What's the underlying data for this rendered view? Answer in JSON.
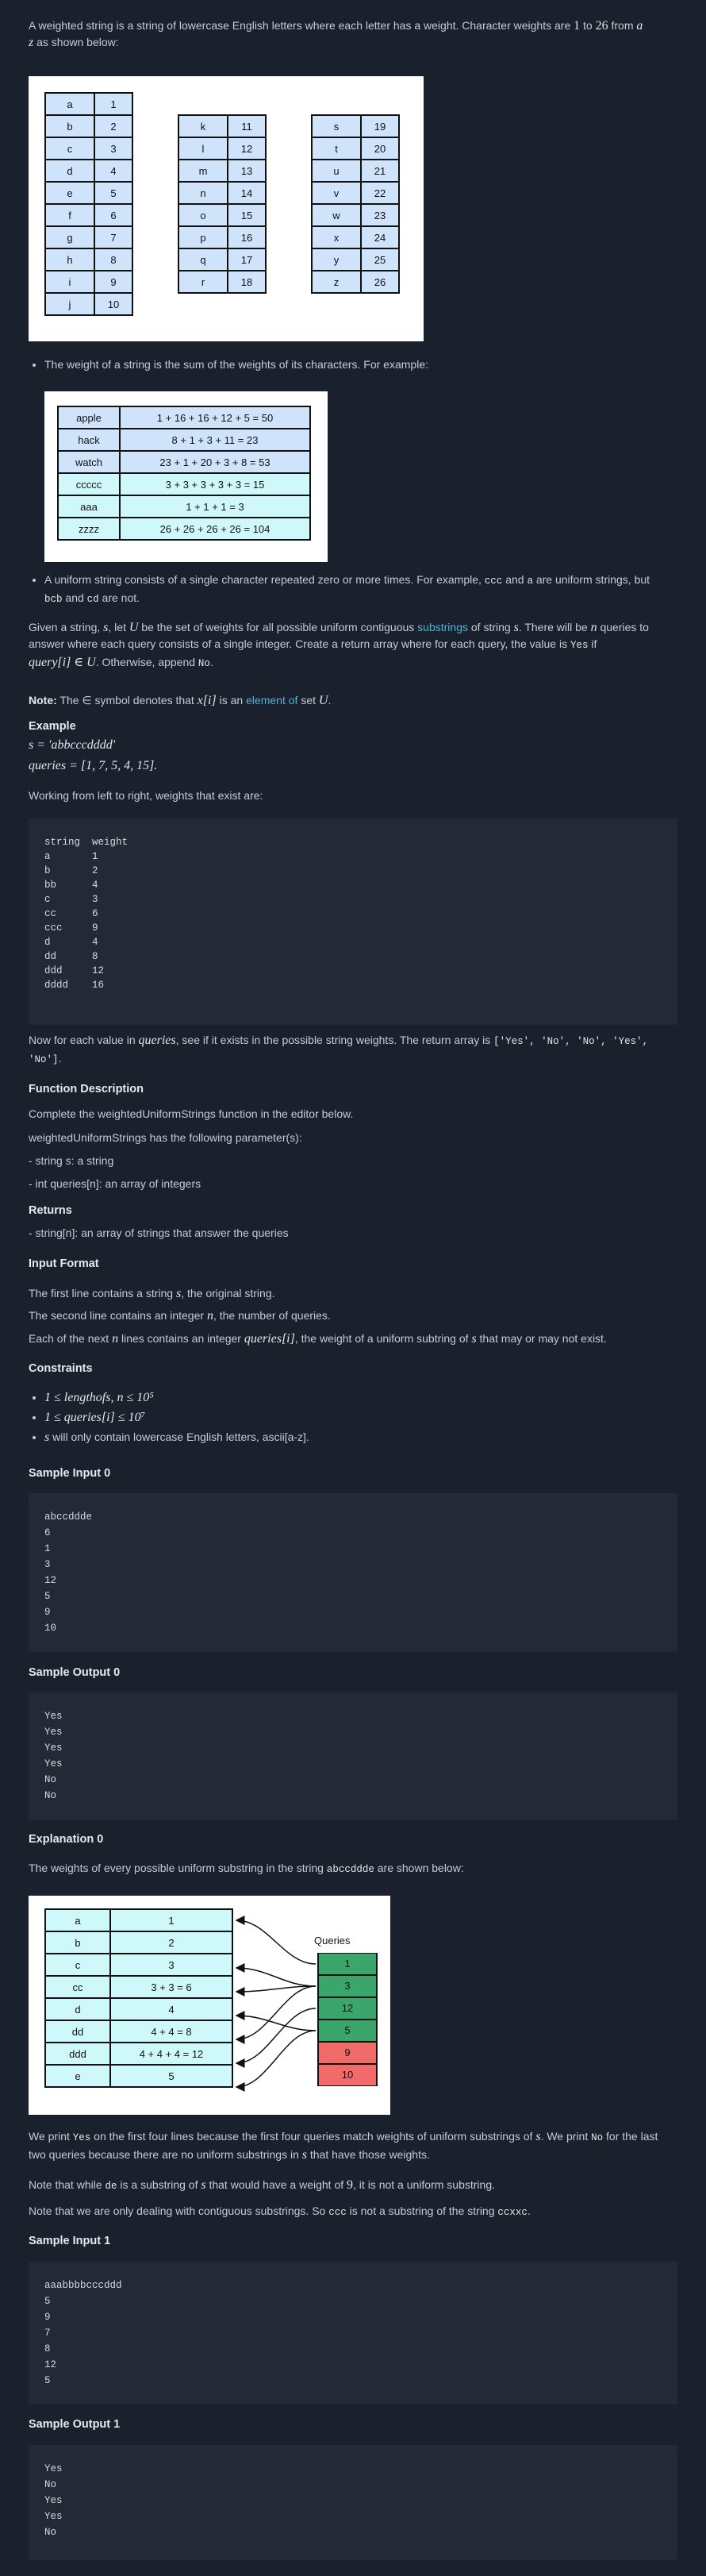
{
  "intro": {
    "text1": "A weighted string is a string of lowercase English letters where each letter has a weight. Character weights are ",
    "n1": "1",
    "to": " to ",
    "n26": "26",
    "from": " from ",
    "a": "a",
    "to2": " to ",
    "z": "z",
    "tail": " as shown below:"
  },
  "weights_table": {
    "col1": [
      [
        "a",
        "1"
      ],
      [
        "b",
        "2"
      ],
      [
        "c",
        "3"
      ],
      [
        "d",
        "4"
      ],
      [
        "e",
        "5"
      ],
      [
        "f",
        "6"
      ],
      [
        "g",
        "7"
      ],
      [
        "h",
        "8"
      ],
      [
        "i",
        "9"
      ],
      [
        "j",
        "10"
      ]
    ],
    "col2": [
      [
        "k",
        "11"
      ],
      [
        "l",
        "12"
      ],
      [
        "m",
        "13"
      ],
      [
        "n",
        "14"
      ],
      [
        "o",
        "15"
      ],
      [
        "p",
        "16"
      ],
      [
        "q",
        "17"
      ],
      [
        "r",
        "18"
      ]
    ],
    "col3": [
      [
        "s",
        "19"
      ],
      [
        "t",
        "20"
      ],
      [
        "u",
        "21"
      ],
      [
        "v",
        "22"
      ],
      [
        "w",
        "23"
      ],
      [
        "x",
        "24"
      ],
      [
        "y",
        "25"
      ],
      [
        "z",
        "26"
      ]
    ]
  },
  "bullet1": "The weight of a string is the sum of the weights of its characters. For example:",
  "examples_table": [
    [
      "apple",
      "1 + 16 + 16 + 12 + 5 = 50"
    ],
    [
      "hack",
      "8 + 1 + 3 + 11 = 23"
    ],
    [
      "watch",
      "23 + 1 + 20 + 3 + 8 = 53"
    ],
    [
      "ccccc",
      "3 + 3 + 3 + 3 + 3 = 15"
    ],
    [
      "aaa",
      "1 + 1 + 1 = 3"
    ],
    [
      "zzzz",
      "26 + 26 + 26 + 26 = 104"
    ]
  ],
  "bullet2": {
    "pre": "A uniform string consists of a single character repeated zero or more times. For example, ",
    "c1": "ccc",
    "mid": " and ",
    "c2": "a",
    "mid2": " are uniform strings, but ",
    "c3": "bcb",
    "mid3": " and ",
    "c4": "cd",
    "post": " are not."
  },
  "given": {
    "p1": "Given a string, ",
    "s": "s",
    "p2": ", let ",
    "U": "U",
    "p3": " be the set of weights for all possible uniform contiguous ",
    "link1": "substrings",
    "p4": " of string ",
    "p5": ". There will be ",
    "n": "n",
    "p6": " queries to answer where each query consists of a single integer. Create a return array where for each query, the value is ",
    "yes": "Yes",
    "p7": " if ",
    "q": "query[i] ∈ U",
    "p8": ". Otherwise, append ",
    "no": "No",
    "p9": "."
  },
  "note": {
    "label": "Note:",
    "p1": " The ∈ symbol denotes that ",
    "xi": "x[i]",
    "p2": " is an ",
    "link": "element of",
    "p3": " set ",
    "U": "U",
    "p4": "."
  },
  "example": {
    "heading": "Example",
    "s_line": "s = 'abbcccdddd'",
    "q_line": "queries = [1, 7, 5, 4, 15].",
    "working": "Working from left to right, weights that exist are:",
    "code": "string  weight\na       1\nb       2\nbb      4\nc       3\ncc      6\nccc     9\nd       4\ndd      8\nddd     12\ndddd    16",
    "after_pre": "Now for each value in ",
    "after_q": "queries",
    "after_mid": ", see if it exists in the possible string weights. The return array is ",
    "after_code": "['Yes', 'No', 'No', 'Yes', 'No']",
    "after_end": "."
  },
  "func": {
    "heading": "Function Description",
    "l1": "Complete the weightedUniformStrings function in the editor below.",
    "l2": "weightedUniformStrings has the following parameter(s):",
    "l3": "- string s: a string",
    "l4": "- int queries[n]: an array of integers",
    "ret_h": "Returns",
    "ret": "- string[n]: an array of strings that answer the queries"
  },
  "input_format": {
    "heading": "Input Format",
    "l1a": "The first line contains a string ",
    "l1b": "s",
    ", the original string.": "",
    "l1c": ", the original string.",
    "l2a": "The second line contains an integer ",
    "l2b": "n",
    "l2c": ", the number of queries.",
    "l3a": "Each of the next ",
    "l3b": "n",
    "l3c": " lines contains an integer ",
    "l3d": "queries[i]",
    "l3e": ", the weight of a uniform subtring of ",
    "l3f": "s",
    "l3g": " that may or may not exist."
  },
  "constraints": {
    "heading": "Constraints",
    "c1": "1 ≤ lengthofs, n ≤ 10⁵",
    "c2": "1 ≤ queries[i] ≤ 10⁷",
    "c3a": "s",
    "c3b": " will only contain lowercase English letters, ascii[a-z]."
  },
  "sample_input0": {
    "heading": "Sample Input 0",
    "code": "abccddde\n6\n1\n3\n12\n5\n9\n10"
  },
  "sample_output0": {
    "heading": "Sample Output 0",
    "code": "Yes\nYes\nYes\nYes\nNo\nNo"
  },
  "explanation0": {
    "heading": "Explanation 0",
    "p1": "The weights of every possible uniform substring in the string ",
    "code": "abccddde",
    "p2": " are shown below:"
  },
  "diagram": {
    "rows": [
      [
        "a",
        "1"
      ],
      [
        "b",
        "2"
      ],
      [
        "c",
        "3"
      ],
      [
        "cc",
        "3 + 3 = 6"
      ],
      [
        "d",
        "4"
      ],
      [
        "dd",
        "4 + 4 = 8"
      ],
      [
        "ddd",
        "4 + 4 + 4 = 12"
      ],
      [
        "e",
        "5"
      ]
    ],
    "queries_label": "Queries",
    "queries": [
      [
        "1",
        "yes"
      ],
      [
        "3",
        "yes"
      ],
      [
        "12",
        "yes"
      ],
      [
        "5",
        "yes"
      ],
      [
        "9",
        "no"
      ],
      [
        "10",
        "no"
      ]
    ],
    "yes_color": "#3aa66b",
    "no_color": "#f26b6b"
  },
  "explain_text": {
    "p1a": "We print ",
    "yes": "Yes",
    "p1b": " on the first four lines because the first four queries match weights of uniform substrings of ",
    "s": "s",
    "p1c": ". We print ",
    "no": "No",
    "p1d": " for the last two queries because there are no uniform substrings in ",
    "p1e": " that have those weights.",
    "p2a": "Note that while ",
    "de": "de",
    "p2b": " is a substring of ",
    "p2c": " that would have a weight of ",
    "nine": "9",
    "p2d": ", it is not a uniform substring.",
    "p3a": "Note that we are only dealing with contiguous substrings. So ",
    "ccc": "ccc",
    "p3b": " is not a substring of the string ",
    "ccxxc": "ccxxc",
    "p3c": "."
  },
  "sample_input1": {
    "heading": "Sample Input 1",
    "code": "aaabbbbcccddd\n5\n9\n7\n8\n12\n5"
  },
  "sample_output1": {
    "heading": "Sample Output 1",
    "code": "Yes\nNo\nYes\nYes\nNo"
  }
}
